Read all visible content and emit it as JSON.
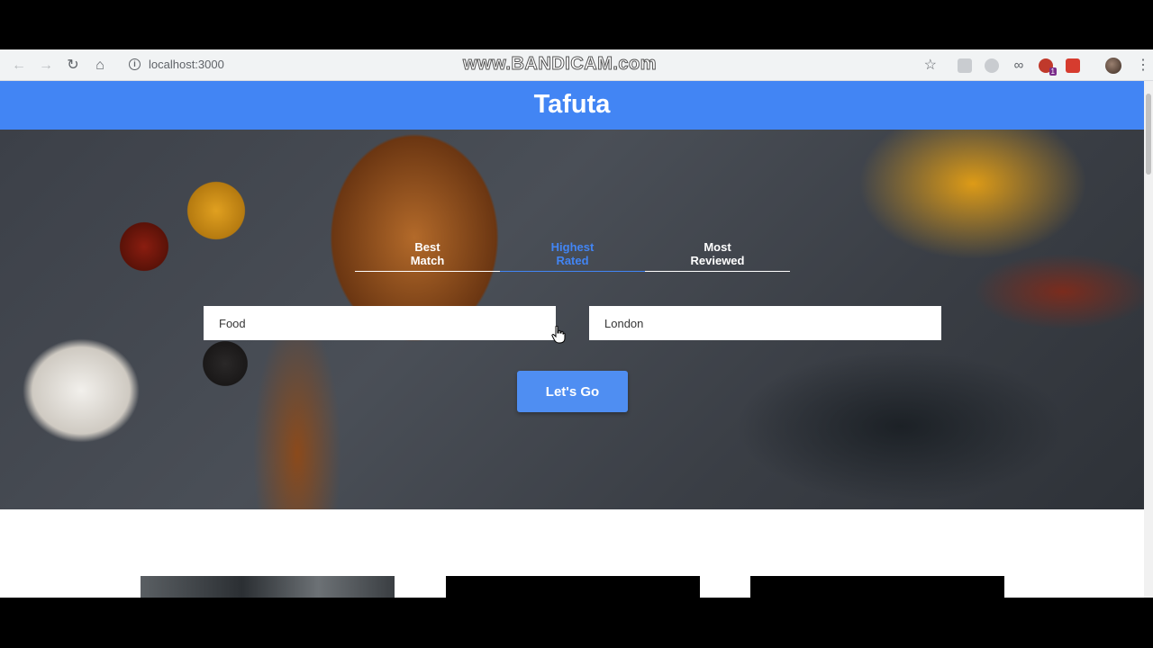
{
  "browser": {
    "url": "localhost:3000",
    "watermark": "www.BANDICAM.com",
    "extension_badge": "1",
    "icons": [
      "back-icon",
      "forward-icon",
      "reload-icon",
      "home-icon",
      "info-icon",
      "star-icon",
      "menu-icon"
    ]
  },
  "header": {
    "title": "Tafuta",
    "color": "#4285f4"
  },
  "hero": {
    "tabs": [
      {
        "line1": "Best",
        "line2": "Match",
        "active": false
      },
      {
        "line1": "Highest",
        "line2": "Rated",
        "active": true
      },
      {
        "line1": "Most",
        "line2": "Reviewed",
        "active": false
      }
    ],
    "search_term": {
      "value": "Food",
      "placeholder": "Food"
    },
    "location": {
      "value": "London",
      "placeholder": "London"
    },
    "submit_label": "Let's Go"
  },
  "colors": {
    "accent": "#4285f4",
    "button": "#4f8ef2"
  }
}
